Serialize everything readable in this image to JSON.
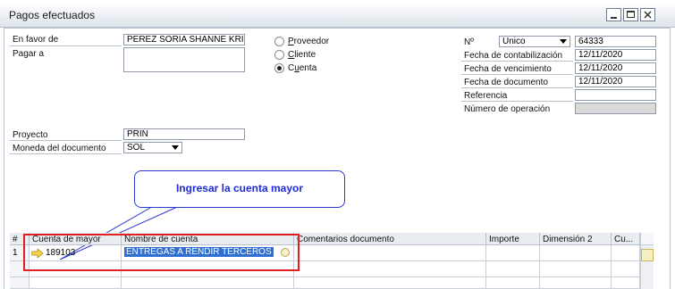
{
  "window": {
    "title": "Pagos efectuados"
  },
  "left": {
    "en_favor_label": "En favor de",
    "en_favor_value": "PEREZ SORIA SHANNE KRISTY",
    "pagar_label": "Pagar a",
    "pagar_value": "",
    "proyecto_label": "Proyecto",
    "proyecto_value": "PRIN",
    "moneda_label": "Moneda del documento",
    "moneda_value": "SOL"
  },
  "radios": [
    {
      "label": "Proveedor",
      "checked": false
    },
    {
      "label": "Cliente",
      "checked": false
    },
    {
      "label": "Cuenta",
      "checked": true
    }
  ],
  "right": {
    "no_label": "Nº",
    "series_value": "Unico",
    "number_value": "64333",
    "fecha_cont_label": "Fecha de contabilización",
    "fecha_cont_value": "12/11/2020",
    "fecha_venc_label": "Fecha de vencimiento",
    "fecha_venc_value": "12/11/2020",
    "fecha_doc_label": "Fecha de documento",
    "fecha_doc_value": "12/11/2020",
    "referencia_label": "Referencia",
    "referencia_value": "",
    "num_op_label": "Número de operación",
    "num_op_value": ""
  },
  "callout": {
    "text": "Ingresar la cuenta mayor"
  },
  "table": {
    "headers": [
      "#",
      "Cuenta de mayor",
      "Nombre de cuenta",
      "Comentarios documento",
      "Importe",
      "Dimensión 2",
      "Cu..."
    ],
    "rows": [
      {
        "num": "1",
        "cuenta": "189103",
        "nombre": "ENTREGAS A RENDIR TERCEROS",
        "comentarios": "",
        "importe": "",
        "dim2": "",
        "cu": ""
      },
      {
        "num": "",
        "cuenta": "",
        "nombre": "",
        "comentarios": "",
        "importe": "",
        "dim2": "",
        "cu": ""
      }
    ]
  },
  "colors": {
    "accent": "#2f6fd1",
    "highlight_box": "#e02020",
    "callout": "#1e2bd6"
  }
}
